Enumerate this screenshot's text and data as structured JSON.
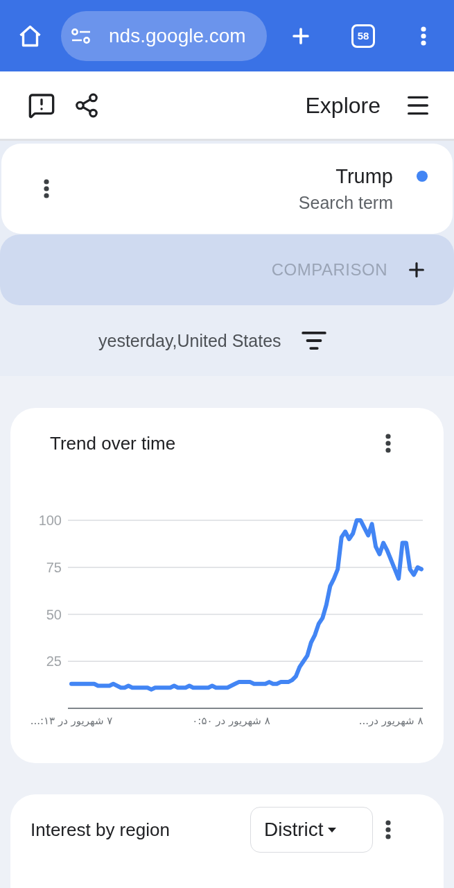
{
  "browser_bar": {
    "url": "nds.google.com",
    "tab_count": "58"
  },
  "header": {
    "title": "Explore"
  },
  "search_terms": [
    {
      "term": "Trump",
      "label": "Search term",
      "color": "#4285f4"
    }
  ],
  "comparison": {
    "label": "COMPARISON"
  },
  "filters": {
    "summary": "yesterday,United States"
  },
  "trend_card": {
    "title": "Trend over time",
    "chart_data": {
      "type": "line",
      "categories": [
        "۷ شهریور در ۱۳:...",
        null,
        null,
        null,
        null,
        null,
        null,
        null,
        null,
        null,
        null,
        null,
        null,
        null,
        null,
        null,
        null,
        null,
        null,
        null,
        null,
        null,
        null,
        null,
        null,
        null,
        null,
        null,
        null,
        null,
        null,
        null,
        null,
        null,
        null,
        null,
        null,
        null,
        null,
        null,
        null,
        null,
        "۸ شهریور در ۰:۵۰",
        null,
        null,
        null,
        null,
        null,
        null,
        null,
        null,
        null,
        null,
        null,
        null,
        null,
        null,
        null,
        null,
        null,
        null,
        null,
        null,
        null,
        null,
        null,
        null,
        null,
        null,
        null,
        null,
        null,
        null,
        null,
        null,
        null,
        null,
        null,
        null,
        null,
        null,
        null,
        null,
        null,
        "۸ شهریور در...",
        null,
        null,
        null,
        null,
        null,
        null,
        null,
        null
      ],
      "series": [
        {
          "color": "#4285f4",
          "values": [
            13,
            13,
            13,
            13,
            13,
            13,
            13,
            12,
            12,
            12,
            12,
            13,
            12,
            11,
            11,
            12,
            11,
            11,
            11,
            11,
            11,
            10,
            11,
            11,
            11,
            11,
            11,
            12,
            11,
            11,
            11,
            12,
            11,
            11,
            11,
            11,
            11,
            12,
            11,
            11,
            11,
            11,
            12,
            13,
            14,
            14,
            14,
            14,
            13,
            13,
            13,
            13,
            14,
            13,
            13,
            14,
            14,
            14,
            15,
            17,
            22,
            25,
            28,
            35,
            39,
            45,
            48,
            55,
            65,
            69,
            74,
            91,
            94,
            90,
            93,
            100,
            100,
            96,
            92,
            98,
            86,
            82,
            88,
            84,
            79,
            74,
            69,
            88,
            88,
            74,
            71,
            75,
            74
          ]
        }
      ],
      "ylim": [
        0,
        100
      ],
      "yticks": [
        25,
        50,
        75,
        100
      ],
      "grid": true
    }
  },
  "region_card": {
    "title": "Interest by region",
    "dropdown": {
      "value": "District"
    }
  }
}
